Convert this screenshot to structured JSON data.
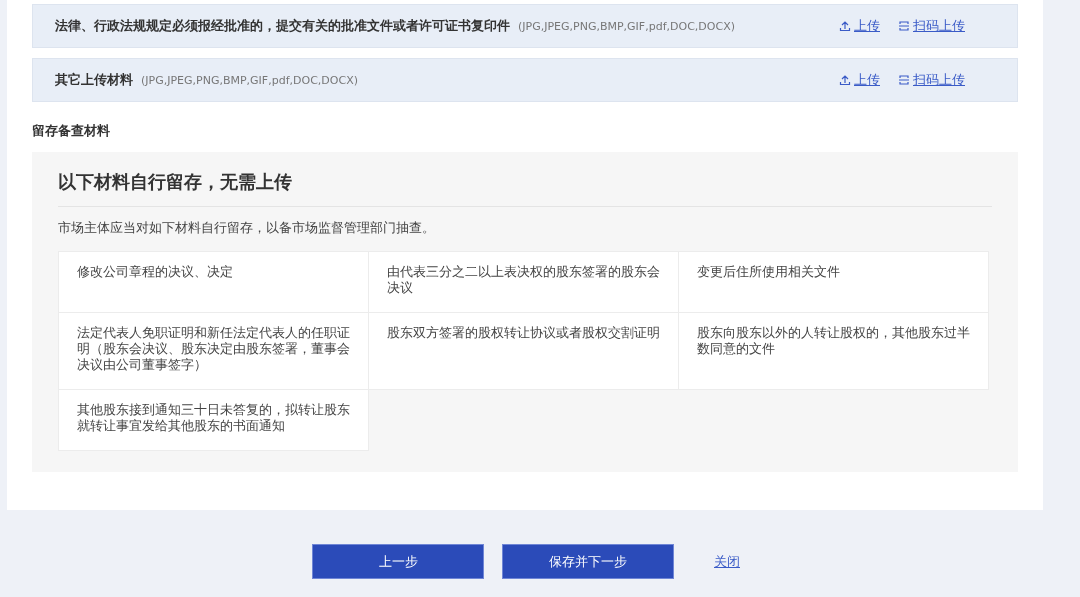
{
  "upload_rows": [
    {
      "title": "法律、行政法规规定必须报经批准的，提交有关的批准文件或者许可证书复印件",
      "formats": "(JPG,JPEG,PNG,BMP,GIF,pdf,DOC,DOCX)",
      "upload_link": "上传",
      "scan_link": "扫码上传"
    },
    {
      "title": "其它上传材料",
      "formats": "(JPG,JPEG,PNG,BMP,GIF,pdf,DOC,DOCX)",
      "upload_link": "上传",
      "scan_link": "扫码上传"
    }
  ],
  "retained_section": {
    "heading": "留存备查材料",
    "panel_title": "以下材料自行留存，无需上传",
    "description": "市场主体应当对如下材料自行留存，以备市场监督管理部门抽查。",
    "items": [
      "修改公司章程的决议、决定",
      "由代表三分之二以上表决权的股东签署的股东会决议",
      "变更后住所使用相关文件",
      "法定代表人免职证明和新任法定代表人的任职证明（股东会决议、股东决定由股东签署，董事会决议由公司董事签字）",
      "股东双方签署的股权转让协议或者股权交割证明",
      "股东向股东以外的人转让股权的，其他股东过半数同意的文件",
      "其他股东接到通知三十日未答复的，拟转让股东就转让事宜发给其他股东的书面通知"
    ]
  },
  "buttons": [
    {
      "label": "上一步",
      "kind": "primary"
    },
    {
      "label": "保存并下一步",
      "kind": "primary"
    },
    {
      "label": "关闭",
      "kind": "link"
    }
  ]
}
